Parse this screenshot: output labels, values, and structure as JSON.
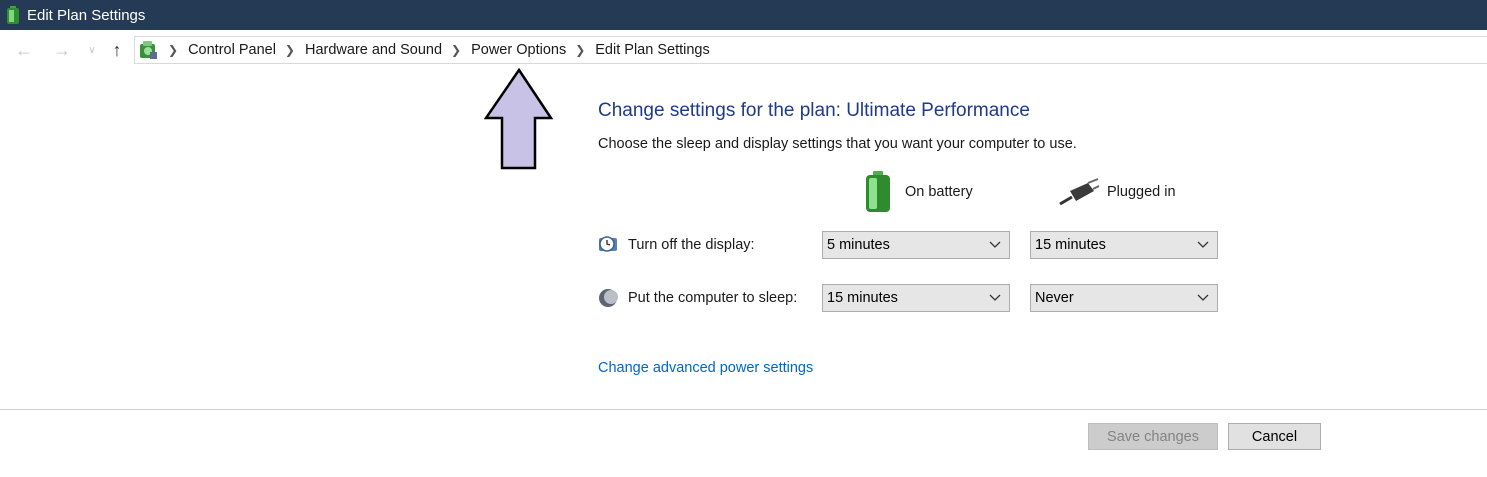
{
  "window": {
    "title": "Edit Plan Settings",
    "icon": "battery-icon"
  },
  "nav": {
    "back_icon": "back-arrow-icon",
    "forward_icon": "forward-arrow-icon",
    "recent_icon": "chevron-down-icon",
    "up_icon": "up-arrow-icon",
    "breadcrumbs": [
      "Control Panel",
      "Hardware and Sound",
      "Power Options",
      "Edit Plan Settings"
    ]
  },
  "main": {
    "heading": "Change settings for the plan: Ultimate Performance",
    "description": "Choose the sleep and display settings that you want your computer to use.",
    "columns": {
      "battery": "On battery",
      "plugged": "Plugged in"
    },
    "rows": [
      {
        "label": "Turn off the display:",
        "icon": "display-clock-icon",
        "battery_value": "5 minutes",
        "plugged_value": "15 minutes"
      },
      {
        "label": "Put the computer to sleep:",
        "icon": "moon-icon",
        "battery_value": "15 minutes",
        "plugged_value": "Never"
      }
    ],
    "advanced_link": "Change advanced power settings"
  },
  "footer": {
    "save_label": "Save changes",
    "cancel_label": "Cancel"
  },
  "colors": {
    "titlebar": "#243a55",
    "heading": "#1e3a8a",
    "link": "#0066cc",
    "annotation_arrow": "#c8c3e6"
  }
}
